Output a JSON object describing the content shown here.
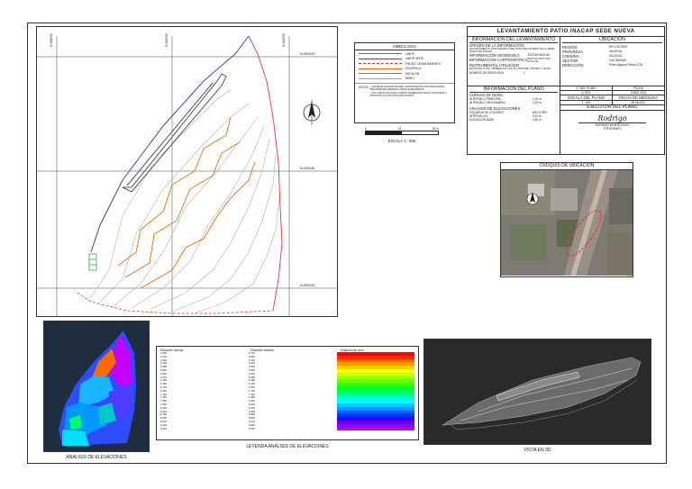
{
  "title_block": {
    "title": "LEVANTAMIENTO PATIO INACAP SEDE NUEVA",
    "info_header": "INFORMACION DEL LEVANTAMIENTO",
    "location_header": "UBICACIÓN",
    "origin_label": "ORIGEN DE LA INFORMACIÓN",
    "origin_text": "LEVANTAMIENTO TOPOGRÁFICO DEL PATIO DELANTERO DE LA SEDE NUEVA DE INACAP",
    "geodesic_label": "INFORMACIÓN GEODESICA",
    "geodesic_value": "DATUM WGS 84",
    "carto_label": "INFORMACIÓN CARTOGRÁFICA",
    "carto_value": "PROYECCIÓN UTM HUSO 18",
    "instrument_label": "INSTRUMENTAL UTILIZADO",
    "instrument_text": "ESTACIÓN TOTAL TRIMBLE M3 CON SU TRIPODE, PRISMA Y JALÓN",
    "bm_label": "NÚMERO DE BENCH B.M.",
    "bm_value": "1",
    "region_label": "REGIÓN",
    "region_value": "DE LOS RÍOS",
    "provincia_label": "PROVINCIA",
    "provincia_value": "VALDIVIA",
    "comuna_label": "COMUNA",
    "comuna_value": "VALDIVIA",
    "sector_label": "SECTOR",
    "sector_value": "LAS ÁNIMAS",
    "direccion_label": "DIRECCIÓN",
    "direccion_value": "Pedro Aguirre Cerda 2715",
    "plano_header": "INFORMACION DEL PLANO",
    "curvas_label": "CURVAS DE NIVEL",
    "int_principal_label": "INTERVALO PRINCIPAL",
    "int_principal_value": "1.00 m",
    "int_secundario_label": "INTERVALO SECUNDARIO",
    "int_secundario_value": "0.20 m",
    "elev_label": "ANALISIS DE ELEVACIONES",
    "esquema_label": "ESQUEMA DE COLORES",
    "esquema_value": "ARCO IRIS",
    "intervalos_label": "INTERVALOS",
    "intervalos_value": "0.22 m",
    "elev_base_label": "ELEVACIÓN BASE",
    "elev_base_value": "4.50 m",
    "n_plano_label": "N° DEL PLANO",
    "fecha_label": "FECHA",
    "n_plano_value": "1/ 2021",
    "fecha_value": "JUNIO 2021",
    "escala_label": "ESCALA DEL PLANO",
    "fecha_med_label": "FECHA DE MENSURA",
    "escala_value": "1 : 600",
    "fecha_med_value": "08.06.2021",
    "ejecutor_header": "EJECUTOR DEL PLANO",
    "signature": "Rodrigo",
    "ejecutor_name": "RODRIGO MONTECINOS",
    "ejecutor_role": "TOPOGRAFO"
  },
  "legend": {
    "title": "SIMBOLOGIA",
    "items": [
      {
        "label": "LÍMITE",
        "color": "#e53935",
        "style": "solid"
      },
      {
        "label": "LÍMITE SEDE",
        "color": "#3949ab",
        "style": "solid"
      },
      {
        "label": "FIN DEL LEVANTAMIENTO",
        "color": "#e53935",
        "style": "dashed"
      },
      {
        "label": "SOLERILLA",
        "color": "#ef6c00",
        "style": "solid"
      },
      {
        "label": "ESCALÓN",
        "color": "#43a047",
        "style": "solid"
      },
      {
        "label": "MURO",
        "color": "#9e9e9e",
        "style": "solid"
      }
    ],
    "notes_label": "NOTAS :",
    "notes": [
      "- LAS BASES DE PARTIDA DEL LEVANTAMIENTO SON REALIZADAS PREVIAMENTE DESDE EL VÉRTICE GEODÉSICO",
      "- LAS CURVAS DE NIVEL FUERON GENERADAS EN EL PROGRAMA A PARTIR DE LOS PUNTOS LEVANTADOS"
    ],
    "scale_ticks": [
      "0",
      "15",
      "30 m"
    ],
    "scale_text": "ESCALA 1 : 600"
  },
  "map": {
    "grid_top": [
      "E=648950",
      "E=649000",
      "E=649050"
    ],
    "grid_right": [
      "N=5591200",
      "N=5591150",
      "N=5591100"
    ]
  },
  "croquis": {
    "title": "CROQUIS DE UBICACIÓN"
  },
  "elevation": {
    "caption": "ANÁLISIS DE ELEVACIONES"
  },
  "elev_legend": {
    "caption": "LEYENDA ANÁLISIS DE ELEVACIONES",
    "col1": "Elevación mínima",
    "col2": "Elevación máxima",
    "col3": "Esquema de color",
    "min_values": [
      "4.500",
      "4.720",
      "4.940",
      "5.160",
      "5.380",
      "5.600",
      "5.820",
      "6.040",
      "6.260",
      "6.480",
      "6.700",
      "6.920",
      "7.140",
      "7.360",
      "7.580",
      "7.800",
      "8.020",
      "8.240",
      "8.460",
      "8.680",
      "8.900",
      "9.120",
      "9.340"
    ],
    "max_values": [
      "4.720",
      "4.940",
      "5.160",
      "5.380",
      "5.600",
      "5.820",
      "6.040",
      "6.260",
      "6.480",
      "6.700",
      "6.920",
      "7.140",
      "7.360",
      "7.580",
      "7.800",
      "8.020",
      "8.240",
      "8.460",
      "8.680",
      "8.900",
      "9.120",
      "9.340",
      "9.560"
    ],
    "colors": [
      "#ff0000",
      "#ff3300",
      "#ff6600",
      "#ff9900",
      "#ffcc00",
      "#ffff00",
      "#ccff00",
      "#99ff00",
      "#66ff00",
      "#33ff00",
      "#00ff33",
      "#00ff66",
      "#00ff99",
      "#00ffcc",
      "#00ffff",
      "#00ccff",
      "#0099ff",
      "#0066ff",
      "#0033ff",
      "#3300ff",
      "#6600ff",
      "#9900ff",
      "#cc00ff"
    ]
  },
  "view3d": {
    "caption": "VISTA EN 3D"
  }
}
